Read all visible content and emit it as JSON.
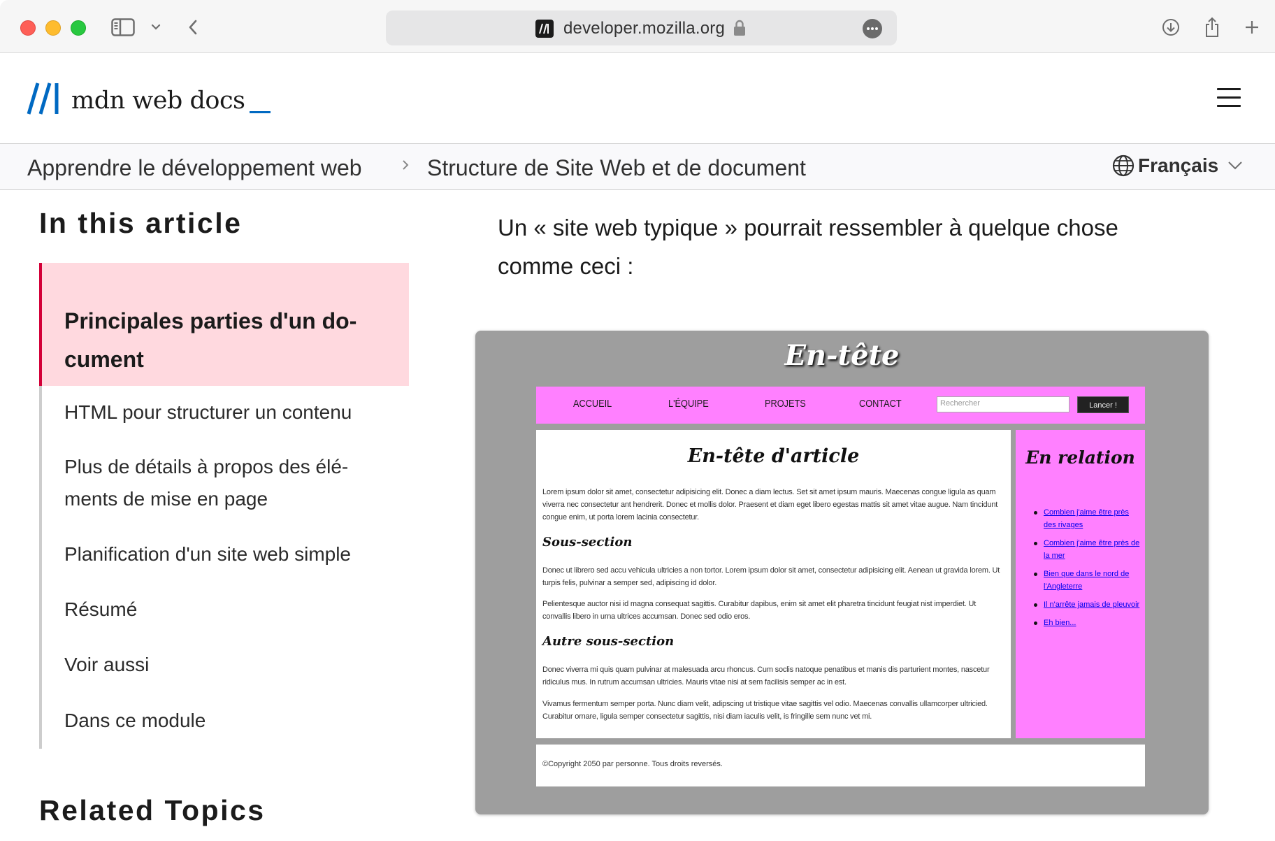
{
  "browser": {
    "url": "developer.mozilla.org"
  },
  "header": {
    "logo_text": "mdn web docs"
  },
  "breadcrumb": {
    "items": [
      "Apprendre le développement web",
      "Structure de Site Web et de document"
    ],
    "language": "Français"
  },
  "sidebar": {
    "heading": "In this article",
    "items": [
      "Principales parties d'un do­cument",
      "HTML pour structurer un contenu",
      "Plus de détails à propos des élé­ments de mise en page",
      "Planification d'un site web simple",
      "Résumé",
      "Voir aussi",
      "Dans ce module"
    ],
    "related_heading": "Related Topics"
  },
  "article": {
    "intro": "Un « site web typique » pourrait ressembler à quelque chose comme ceci :"
  },
  "example": {
    "header_title": "En-tête",
    "nav": [
      "ACCUEIL",
      "L'ÉQUIPE",
      "PROJETS",
      "CONTACT"
    ],
    "search_placeholder": "Rechercher",
    "search_button": "Lancer !",
    "article_title": "En-tête d'article",
    "p1": "Lorem ipsum dolor sit amet, consectetur adipisicing elit. Donec a diam lectus. Set sit amet ipsum mauris. Maecenas congue ligula as quam viverra nec consectetur ant hendrerit. Donec et mollis dolor. Praesent et diam eget libero egestas mattis sit amet vitae augue. Nam tincidunt congue enim, ut porta lorem lacinia consectetur.",
    "subsection1": "Sous-section",
    "p2": "Donec ut librero sed accu vehicula ultricies a non tortor. Lorem ipsum dolor sit amet, consectetur adipisicing elit. Aenean ut gravida lorem. Ut turpis felis, pulvinar a semper sed, adipiscing id dolor.",
    "p3": "Pelientesque auctor nisi id magna consequat sagittis. Curabitur dapibus, enim sit amet elit pharetra tincidunt feugiat nist imperdiet. Ut convallis libero in urna ultrices accumsan. Donec sed odio eros.",
    "subsection2": "Autre sous-section",
    "p4": "Donec viverra mi quis quam pulvinar at malesuada arcu rhoncus. Cum soclis natoque penatibus et manis dis parturient montes, nascetur ridiculus mus. In rutrum accumsan ultricies. Mauris vitae nisi at sem facilisis semper ac in est.",
    "p5": "Vivamus fermentum semper porta. Nunc diam velit, adipscing ut tristique vitae sagittis vel odio. Maecenas convallis ullamcorper ultricied. Curabitur ornare, ligula semper consectetur sagittis, nisi diam iaculis velit, is fringille sem nunc vet mi.",
    "aside_title": "En relation",
    "aside_links": [
      "Combien j'aime être près des rivages",
      "Combien j'aime être près de la mer",
      "Bien que dans le nord de l'Angleterre",
      "Il n'arrête jamais de pleuvoir",
      "Eh bien..."
    ],
    "footer": "©Copyright 2050 par personne. Tous droits reversés."
  }
}
